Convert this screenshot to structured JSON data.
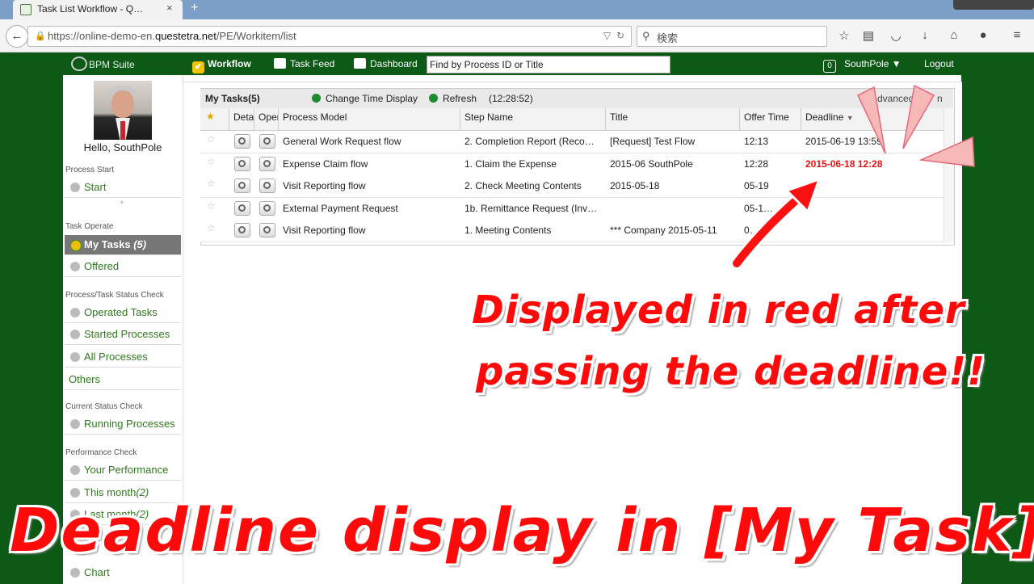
{
  "browser": {
    "tab_title": "Task List Workflow - Q…",
    "tab_close": "×",
    "new_tab": "+",
    "url_prefix": "https://online-demo-en.",
    "url_domain": "questetra.net",
    "url_path": "/PE/Workitem/list",
    "search_placeholder": "検索"
  },
  "app": {
    "logo_text": "BPM Suite",
    "nav": [
      {
        "label": "Workflow",
        "active": true
      },
      {
        "label": "Task Feed"
      },
      {
        "label": "Dashboard"
      }
    ],
    "search_value": "Find by Process ID or Title",
    "badge_count": "0",
    "user_menu": "SouthPole ▼",
    "logout": "Logout"
  },
  "sidebar": {
    "greeting": "Hello, SouthPole",
    "sections": [
      {
        "title": "Process Start",
        "items": [
          {
            "label": "Start"
          }
        ]
      },
      {
        "title": "Task Operate",
        "items": [
          {
            "label": "My Tasks",
            "count": "(5)",
            "active": true
          },
          {
            "label": "Offered"
          }
        ]
      },
      {
        "title": "Process/Task Status Check",
        "items": [
          {
            "label": "Operated Tasks"
          },
          {
            "label": "Started Processes"
          },
          {
            "label": "All Processes"
          }
        ]
      },
      {
        "title": "",
        "items": [
          {
            "label": "Others"
          }
        ]
      },
      {
        "title": "Current Status Check",
        "items": [
          {
            "label": "Running Processes"
          }
        ]
      },
      {
        "title": "Performance Check",
        "items": [
          {
            "label": "Your Performance"
          },
          {
            "label": "This month",
            "count": "(2)"
          },
          {
            "label": "Last month",
            "count": "(2)"
          }
        ]
      },
      {
        "title": "",
        "items": [
          {
            "label": "Chart"
          }
        ]
      }
    ],
    "expand_marker": "+"
  },
  "tasks": {
    "title": "My Tasks(5)",
    "change_time_display": "Change Time Display",
    "refresh": "Refresh",
    "time": "(12:28:52)",
    "advanced": "Advanced",
    "advanced_tail": "n",
    "columns": {
      "star": "★",
      "detail": "Detail",
      "operate": "Operate",
      "process_model": "Process Model",
      "step_name": "Step Name",
      "title": "Title",
      "offer_time": "Offer Time",
      "deadline": "Deadline"
    },
    "sort_indicator": "▼",
    "star_glyph": "☆",
    "rows": [
      {
        "process_model": "General Work Request flow",
        "step_name": "2. Completion Report (Reco…",
        "title": "[Request] Test Flow",
        "offer_time": "12:13",
        "deadline": "2015-06-19 13:59",
        "overdue": false
      },
      {
        "process_model": "Expense Claim flow",
        "step_name": "1. Claim the Expense",
        "title": "2015-06 SouthPole",
        "offer_time": "12:28",
        "deadline": "2015-06-18 12:28",
        "overdue": true
      },
      {
        "process_model": "Visit Reporting flow",
        "step_name": "2. Check Meeting Contents",
        "title": "2015-05-18",
        "offer_time": "05-19",
        "deadline": "",
        "overdue": false
      },
      {
        "process_model": "External Payment Request",
        "step_name": "1b. Remittance Request (Inv…",
        "title": "",
        "offer_time": "05-1…",
        "deadline": "",
        "overdue": false
      },
      {
        "process_model": "Visit Reporting flow",
        "step_name": "1. Meeting Contents",
        "title": "*** Company 2015-05-11",
        "offer_time": "0…",
        "deadline": "",
        "overdue": false
      }
    ]
  },
  "annotations": {
    "line1": "Displayed in red after",
    "line2": "passing the deadline!!",
    "headline": "Deadline display in [My Task]"
  },
  "colors": {
    "app_green": "#0c5a16",
    "link_green": "#2f7b1c",
    "overdue_red": "#e11111",
    "annotation_red": "#ff0a0a",
    "arrow_pink": "#f7b8b8"
  }
}
